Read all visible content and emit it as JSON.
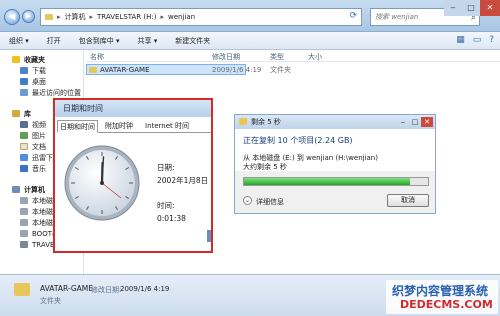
{
  "address": {
    "segments": [
      "计算机",
      "TRAVELSTAR (H:)",
      "wenjian"
    ],
    "search_placeholder": "搜索 wenjian"
  },
  "toolbar": {
    "items": [
      "组织 ▾",
      "打开",
      "包含到库中 ▾",
      "共享 ▾",
      "新建文件夹"
    ]
  },
  "sidebar": {
    "items": [
      {
        "label": "收藏夹",
        "icon": "star-icon",
        "head": true
      },
      {
        "label": "下载",
        "icon": "download-folder-icon"
      },
      {
        "label": "桌面",
        "icon": "desktop-icon"
      },
      {
        "label": "最近访问的位置",
        "icon": "recent-places-icon"
      },
      {
        "label": "库",
        "icon": "library-icon",
        "head": true
      },
      {
        "label": "视频",
        "icon": "video-icon"
      },
      {
        "label": "图片",
        "icon": "pictures-icon"
      },
      {
        "label": "文档",
        "icon": "documents-icon"
      },
      {
        "label": "迅雷下载",
        "icon": "thunder-download-icon"
      },
      {
        "label": "音乐",
        "icon": "music-icon"
      },
      {
        "label": "计算机",
        "icon": "computer-icon",
        "head": true
      },
      {
        "label": "本地磁盘",
        "icon": "drive-icon"
      },
      {
        "label": "本地磁盘",
        "icon": "drive-icon"
      },
      {
        "label": "本地磁盘",
        "icon": "drive-icon"
      },
      {
        "label": "BOOT&K",
        "icon": "drive-icon"
      },
      {
        "label": "TRAVELSTAR (H:)",
        "icon": "usb-drive-icon"
      }
    ]
  },
  "filelist": {
    "columns": [
      "名称",
      "修改日期",
      "类型",
      "大小"
    ],
    "rows": [
      {
        "name": "AVATAR-GAME",
        "modified": "2009/1/6 4:19",
        "type": "文件夹",
        "size": ""
      }
    ]
  },
  "datetime_window": {
    "title": "日期和时间",
    "tabs": [
      "日期和时间",
      "附加时钟",
      "Internet 时间"
    ],
    "date_label": "日期:",
    "date_value": "2002年1月8日",
    "time_label": "时间:",
    "time_value": "0:01:38"
  },
  "copy_dialog": {
    "title": "剩余 5 秒",
    "heading": "正在复制 10 个项目(2.24 GB)",
    "from_line": "从 本地磁盘 (E:) 到 wenjian (H:\\wenjian)",
    "remaining": "大约剩余 5 秒",
    "progress_fraction": 0.9,
    "details_label": "详细信息",
    "cancel_label": "取消"
  },
  "statusbar": {
    "name": "AVATAR-GAME",
    "modified_label": "修改日期:",
    "modified_value": "2009/1/6 4:19",
    "type": "文件夹"
  },
  "watermark": {
    "line1": "织梦内容管理系统",
    "line2": "DEDECMS.COM"
  },
  "colors": {
    "highlight_border": "#d42a2a",
    "progress": "#27a627",
    "selection": "#cde4fb"
  }
}
